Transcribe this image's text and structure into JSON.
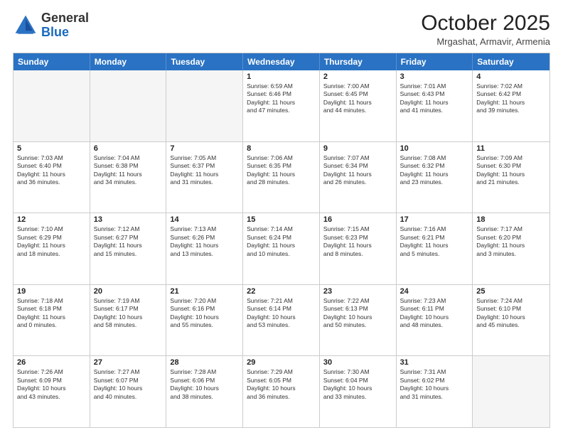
{
  "logo": {
    "general": "General",
    "blue": "Blue"
  },
  "header": {
    "month": "October 2025",
    "location": "Mrgashat, Armavir, Armenia"
  },
  "days": [
    "Sunday",
    "Monday",
    "Tuesday",
    "Wednesday",
    "Thursday",
    "Friday",
    "Saturday"
  ],
  "weeks": [
    [
      {
        "day": "",
        "content": ""
      },
      {
        "day": "",
        "content": ""
      },
      {
        "day": "",
        "content": ""
      },
      {
        "day": "1",
        "content": "Sunrise: 6:59 AM\nSunset: 6:46 PM\nDaylight: 11 hours\nand 47 minutes."
      },
      {
        "day": "2",
        "content": "Sunrise: 7:00 AM\nSunset: 6:45 PM\nDaylight: 11 hours\nand 44 minutes."
      },
      {
        "day": "3",
        "content": "Sunrise: 7:01 AM\nSunset: 6:43 PM\nDaylight: 11 hours\nand 41 minutes."
      },
      {
        "day": "4",
        "content": "Sunrise: 7:02 AM\nSunset: 6:42 PM\nDaylight: 11 hours\nand 39 minutes."
      }
    ],
    [
      {
        "day": "5",
        "content": "Sunrise: 7:03 AM\nSunset: 6:40 PM\nDaylight: 11 hours\nand 36 minutes."
      },
      {
        "day": "6",
        "content": "Sunrise: 7:04 AM\nSunset: 6:38 PM\nDaylight: 11 hours\nand 34 minutes."
      },
      {
        "day": "7",
        "content": "Sunrise: 7:05 AM\nSunset: 6:37 PM\nDaylight: 11 hours\nand 31 minutes."
      },
      {
        "day": "8",
        "content": "Sunrise: 7:06 AM\nSunset: 6:35 PM\nDaylight: 11 hours\nand 28 minutes."
      },
      {
        "day": "9",
        "content": "Sunrise: 7:07 AM\nSunset: 6:34 PM\nDaylight: 11 hours\nand 26 minutes."
      },
      {
        "day": "10",
        "content": "Sunrise: 7:08 AM\nSunset: 6:32 PM\nDaylight: 11 hours\nand 23 minutes."
      },
      {
        "day": "11",
        "content": "Sunrise: 7:09 AM\nSunset: 6:30 PM\nDaylight: 11 hours\nand 21 minutes."
      }
    ],
    [
      {
        "day": "12",
        "content": "Sunrise: 7:10 AM\nSunset: 6:29 PM\nDaylight: 11 hours\nand 18 minutes."
      },
      {
        "day": "13",
        "content": "Sunrise: 7:12 AM\nSunset: 6:27 PM\nDaylight: 11 hours\nand 15 minutes."
      },
      {
        "day": "14",
        "content": "Sunrise: 7:13 AM\nSunset: 6:26 PM\nDaylight: 11 hours\nand 13 minutes."
      },
      {
        "day": "15",
        "content": "Sunrise: 7:14 AM\nSunset: 6:24 PM\nDaylight: 11 hours\nand 10 minutes."
      },
      {
        "day": "16",
        "content": "Sunrise: 7:15 AM\nSunset: 6:23 PM\nDaylight: 11 hours\nand 8 minutes."
      },
      {
        "day": "17",
        "content": "Sunrise: 7:16 AM\nSunset: 6:21 PM\nDaylight: 11 hours\nand 5 minutes."
      },
      {
        "day": "18",
        "content": "Sunrise: 7:17 AM\nSunset: 6:20 PM\nDaylight: 11 hours\nand 3 minutes."
      }
    ],
    [
      {
        "day": "19",
        "content": "Sunrise: 7:18 AM\nSunset: 6:18 PM\nDaylight: 11 hours\nand 0 minutes."
      },
      {
        "day": "20",
        "content": "Sunrise: 7:19 AM\nSunset: 6:17 PM\nDaylight: 10 hours\nand 58 minutes."
      },
      {
        "day": "21",
        "content": "Sunrise: 7:20 AM\nSunset: 6:16 PM\nDaylight: 10 hours\nand 55 minutes."
      },
      {
        "day": "22",
        "content": "Sunrise: 7:21 AM\nSunset: 6:14 PM\nDaylight: 10 hours\nand 53 minutes."
      },
      {
        "day": "23",
        "content": "Sunrise: 7:22 AM\nSunset: 6:13 PM\nDaylight: 10 hours\nand 50 minutes."
      },
      {
        "day": "24",
        "content": "Sunrise: 7:23 AM\nSunset: 6:11 PM\nDaylight: 10 hours\nand 48 minutes."
      },
      {
        "day": "25",
        "content": "Sunrise: 7:24 AM\nSunset: 6:10 PM\nDaylight: 10 hours\nand 45 minutes."
      }
    ],
    [
      {
        "day": "26",
        "content": "Sunrise: 7:26 AM\nSunset: 6:09 PM\nDaylight: 10 hours\nand 43 minutes."
      },
      {
        "day": "27",
        "content": "Sunrise: 7:27 AM\nSunset: 6:07 PM\nDaylight: 10 hours\nand 40 minutes."
      },
      {
        "day": "28",
        "content": "Sunrise: 7:28 AM\nSunset: 6:06 PM\nDaylight: 10 hours\nand 38 minutes."
      },
      {
        "day": "29",
        "content": "Sunrise: 7:29 AM\nSunset: 6:05 PM\nDaylight: 10 hours\nand 36 minutes."
      },
      {
        "day": "30",
        "content": "Sunrise: 7:30 AM\nSunset: 6:04 PM\nDaylight: 10 hours\nand 33 minutes."
      },
      {
        "day": "31",
        "content": "Sunrise: 7:31 AM\nSunset: 6:02 PM\nDaylight: 10 hours\nand 31 minutes."
      },
      {
        "day": "",
        "content": ""
      }
    ]
  ]
}
